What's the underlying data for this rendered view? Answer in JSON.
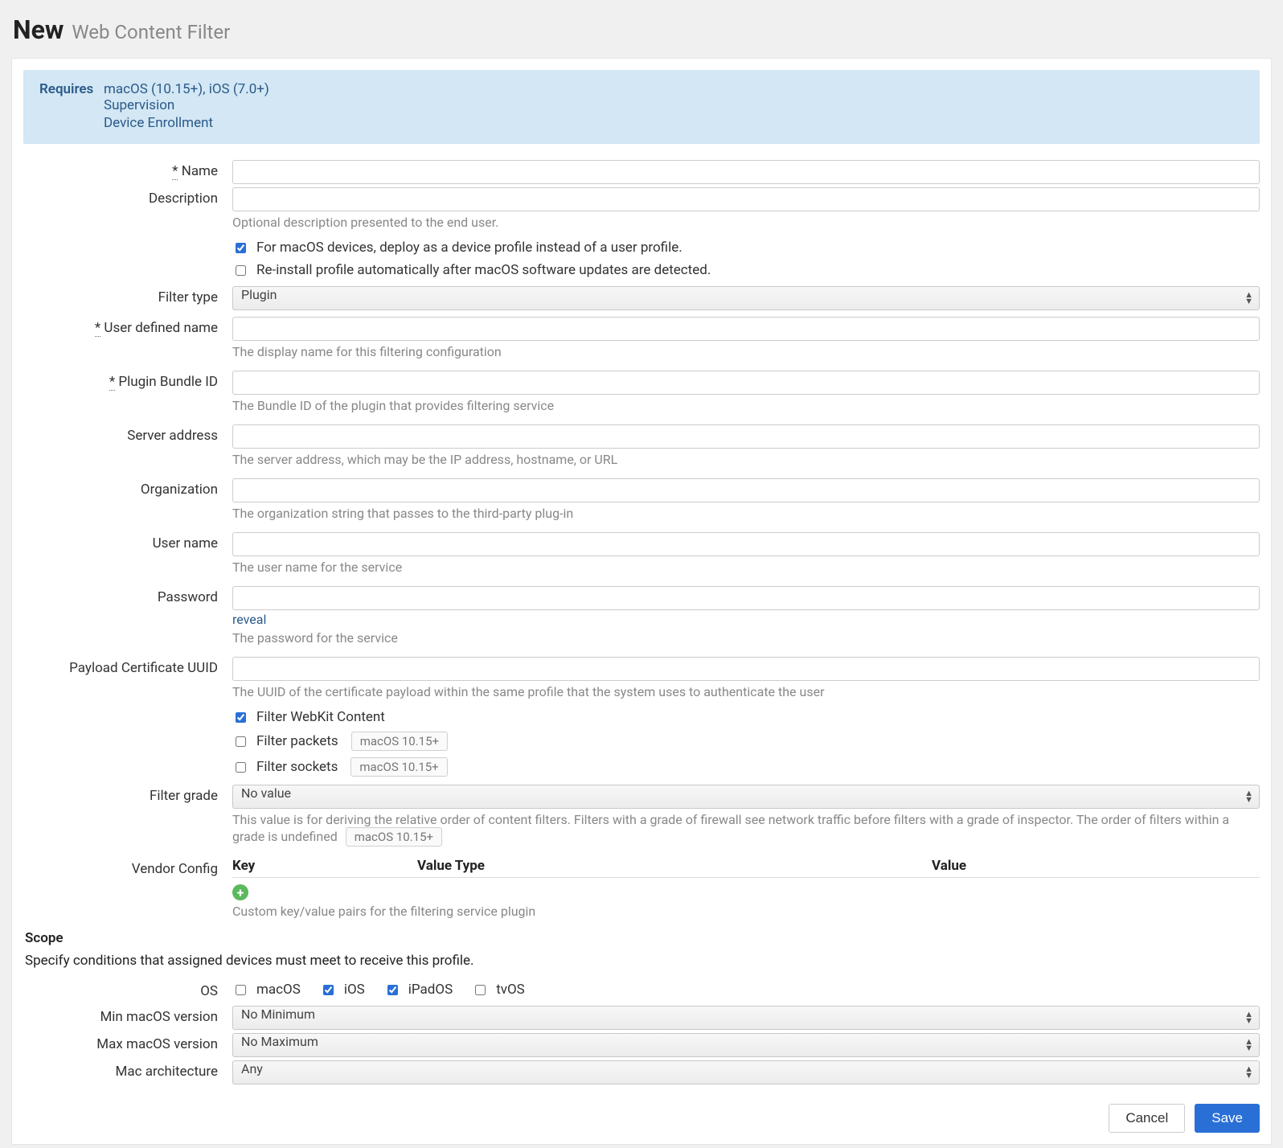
{
  "header": {
    "title": "New",
    "subtitle": "Web Content Filter"
  },
  "requires": {
    "label": "Requires",
    "os_line": "macOS (10.15+), iOS (7.0+)",
    "links": [
      "Supervision",
      "Device Enrollment"
    ]
  },
  "labels": {
    "name": "Name",
    "description": "Description",
    "filter_type": "Filter type",
    "user_defined_name": "User defined name",
    "plugin_bundle_id": "Plugin Bundle ID",
    "server_address": "Server address",
    "organization": "Organization",
    "user_name": "User name",
    "password": "Password",
    "payload_cert_uuid": "Payload Certificate UUID",
    "filter_grade": "Filter grade",
    "vendor_config": "Vendor Config",
    "os": "OS",
    "min_macos": "Min macOS version",
    "max_macos": "Max macOS version",
    "mac_arch": "Mac architecture",
    "star": "*"
  },
  "helpers": {
    "description": "Optional description presented to the end user.",
    "user_defined_name": "The display name for this filtering configuration",
    "plugin_bundle_id": "The Bundle ID of the plugin that provides filtering service",
    "server_address": "The server address, which may be the IP address, hostname, or URL",
    "organization": "The organization string that passes to the third-party plug-in",
    "user_name": "The user name for the service",
    "password": "The password for the service",
    "payload_cert_uuid": "The UUID of the certificate payload within the same profile that the system uses to authenticate the user",
    "filter_grade": "This value is for deriving the relative order of content filters. Filters with a grade of firewall see network traffic before filters with a grade of inspector. The order of filters within a grade is undefined",
    "vendor_config": "Custom key/value pairs for the filtering service plugin"
  },
  "checkboxes": {
    "device_profile": {
      "label": "For macOS devices, deploy as a device profile instead of a user profile.",
      "checked": true
    },
    "reinstall": {
      "label": "Re-install profile automatically after macOS software updates are detected.",
      "checked": false
    },
    "filter_webkit": {
      "label": "Filter WebKit Content",
      "checked": true
    },
    "filter_packets": {
      "label": "Filter packets",
      "checked": false
    },
    "filter_sockets": {
      "label": "Filter sockets",
      "checked": false
    }
  },
  "tags": {
    "macos1015": "macOS 10.15+"
  },
  "selects": {
    "filter_type": "Plugin",
    "filter_grade": "No value",
    "min_macos": "No Minimum",
    "max_macos": "No Maximum",
    "mac_arch": "Any"
  },
  "reveal": "reveal",
  "vendor_table": {
    "col1": "Key",
    "col2": "Value Type",
    "col3": "Value"
  },
  "scope": {
    "title": "Scope",
    "desc": "Specify conditions that assigned devices must meet to receive this profile.",
    "os": {
      "macOS": {
        "label": "macOS",
        "checked": false
      },
      "iOS": {
        "label": "iOS",
        "checked": true
      },
      "iPadOS": {
        "label": "iPadOS",
        "checked": true
      },
      "tvOS": {
        "label": "tvOS",
        "checked": false
      }
    }
  },
  "buttons": {
    "cancel": "Cancel",
    "save": "Save"
  }
}
